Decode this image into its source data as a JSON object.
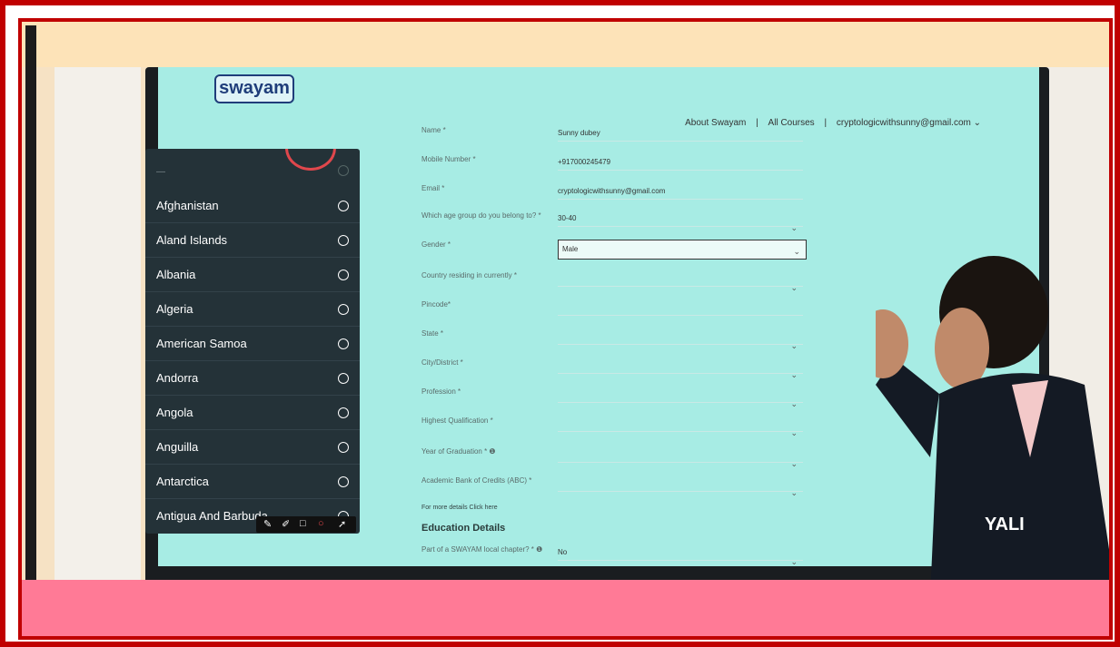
{
  "header": {
    "logo": "swayam",
    "nav": [
      "About Swayam",
      "|",
      "All Courses",
      "|",
      "cryptologicwithsunny@gmail.com ⌄"
    ]
  },
  "form": {
    "rows": [
      {
        "label": "Name *",
        "value": "Sunny dubey"
      },
      {
        "label": "Mobile Number *",
        "value": "+917000245479"
      },
      {
        "label": "Email *",
        "value": "cryptologicwithsunny@gmail.com"
      },
      {
        "label": "Which age group do you belong to? *",
        "value": "30-40"
      },
      {
        "label": "Gender *",
        "value": "Male"
      },
      {
        "label": "Country residing in currently *",
        "value": ""
      },
      {
        "label": "Pincode*",
        "value": ""
      },
      {
        "label": "State *",
        "value": ""
      },
      {
        "label": "City/District *",
        "value": ""
      },
      {
        "label": "Profession *",
        "value": ""
      },
      {
        "label": "Highest Qualification *",
        "value": ""
      },
      {
        "label": "Year of Graduation * ❶",
        "value": ""
      },
      {
        "label": "Academic Bank of Credits (ABC) *",
        "value": ""
      }
    ],
    "abc_hint": "For more details Click here",
    "education_title": "Education Details",
    "chapter_label": "Part of a SWAYAM local chapter? * ❶",
    "chapter_value": "No"
  },
  "country_dropdown": {
    "placeholder": "—",
    "options": [
      "Afghanistan",
      "Aland Islands",
      "Albania",
      "Algeria",
      "American Samoa",
      "Andorra",
      "Angola",
      "Anguilla",
      "Antarctica",
      "Antigua And Barbuda"
    ]
  },
  "annotation_tools": [
    "pen-icon",
    "highlighter-icon",
    "rectangle-icon",
    "circle-icon",
    "arrow-icon"
  ],
  "colors": {
    "frame": "#c00000",
    "screen_bg": "#a7ece4",
    "dropdown_bg": "#243238",
    "bottom_band": "#ff7a96",
    "top_band": "#fde3b8"
  }
}
